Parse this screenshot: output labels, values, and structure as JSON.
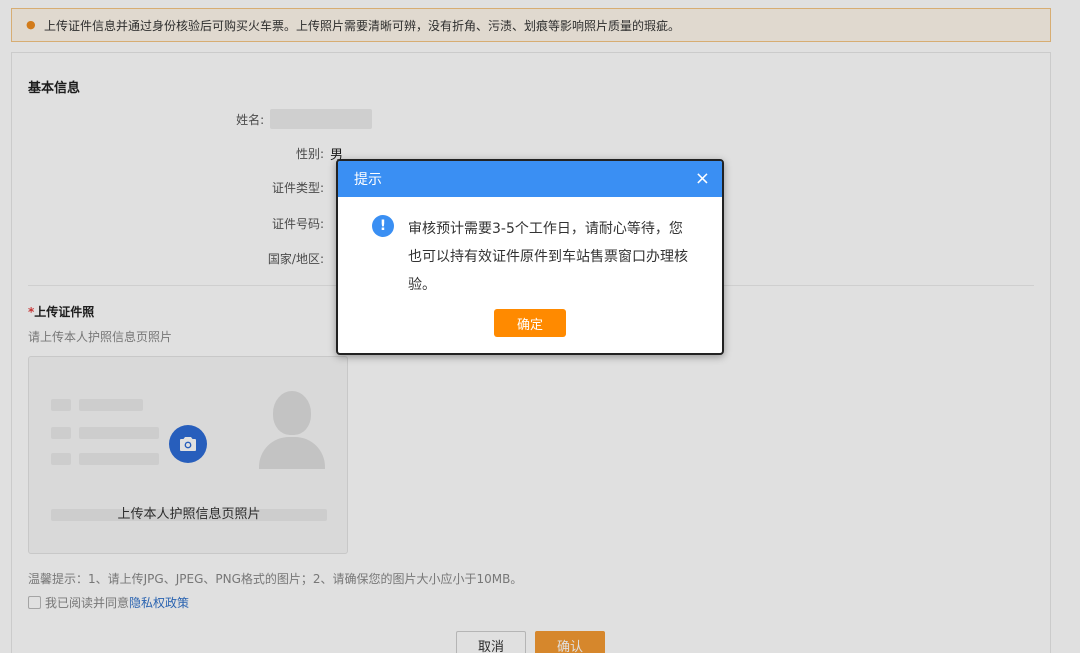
{
  "notice": {
    "icon": "bulb-icon",
    "text": "上传证件信息并通过身份核验后可购买火车票。上传照片需要清晰可辨，没有折角、污渍、划痕等影响照片质量的瑕疵。"
  },
  "basic_info": {
    "title": "基本信息",
    "fields": [
      {
        "label": "姓名:",
        "value": ""
      },
      {
        "label": "性别:",
        "value": "男"
      },
      {
        "label": "证件类型:",
        "value": ""
      },
      {
        "label": "证件号码:",
        "value": ""
      },
      {
        "label": "国家/地区:",
        "value": ""
      }
    ]
  },
  "upload": {
    "required_mark": "*",
    "title": "上传证件照",
    "subtitle": "请上传本人护照信息页照片",
    "box_label": "上传本人护照信息页照片"
  },
  "tip": "温馨提示：1、请上传JPG、JPEG、PNG格式的图片；2、请确保您的图片大小应小于10MB。",
  "agreement": {
    "prefix": "我已阅读并同意",
    "link": "隐私权政策"
  },
  "buttons": {
    "cancel": "取消",
    "confirm": "确认"
  },
  "dialog": {
    "title": "提示",
    "close": "×",
    "icon_glyph": "!",
    "message": "审核预计需要3-5个工作日，请耐心等待，您也可以持有效证件原件到车站售票窗口办理核验。",
    "ok": "确定"
  },
  "colors": {
    "accent_blue": "#3a8ff3",
    "accent_orange": "#ff8a00",
    "link": "#3071c9"
  }
}
